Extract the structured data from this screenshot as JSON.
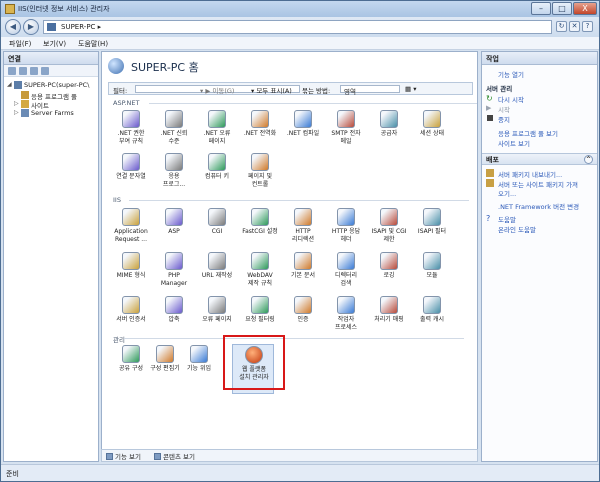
{
  "window": {
    "title": "IIS(인터넷 정보 서비스) 관리자",
    "min_label": "–",
    "max_label": "□",
    "close_label": "X"
  },
  "address": {
    "back": "◀",
    "forward": "▶",
    "path": "SUPER-PC ▸"
  },
  "menu": {
    "file": "파일(F)",
    "view": "보기(V)",
    "help": "도움말(H)"
  },
  "connections": {
    "header": "연결",
    "tree": [
      {
        "label": "SUPER-PC(super-PC\\",
        "expander": "◢"
      },
      {
        "label": "응용 프로그램 풀",
        "expander": ""
      },
      {
        "label": "사이트",
        "expander": "▷"
      },
      {
        "label": "Server Farms",
        "expander": "▷"
      }
    ]
  },
  "center": {
    "title": "SUPER-PC 홈",
    "filter": {
      "label": "필터:",
      "go": "▾ ▶ 이동(G)",
      "show_all": "▾ 모두 표시(A)",
      "group_by": "묶는 방법:",
      "group_value": "영역"
    },
    "categories": [
      "ASP.NET",
      "IIS",
      "관리"
    ],
    "aspnet_tiles": [
      ".NET 권한\n부여 규칙",
      ".NET 신뢰\n수준",
      ".NET 오류\n페이지",
      ".NET 전역화",
      ".NET 컴파일",
      "SMTP 전자\n메일",
      "공급자",
      "세션 상태",
      "연결 문자열",
      "응용\n프로그...",
      "컴퓨터 키",
      "페이지 및\n컨트롤"
    ],
    "iis_tiles": [
      "Application\nRequest ...",
      "ASP",
      "CGI",
      "FastCGI 설정",
      "HTTP\n리디렉션",
      "HTTP 응답\n헤더",
      "ISAPI 및 CGI\n제한",
      "ISAPI 필터",
      "MIME 형식",
      "PHP\nManager",
      "URL 재작성",
      "WebDAV\n제작 규칙",
      "기본 문서",
      "디렉터리\n검색",
      "로깅",
      "모듈",
      "서버 인증서",
      "압축",
      "오류 페이지",
      "요청 필터링",
      "인증",
      "작업자\n프로세스",
      "처리기 매핑",
      "출력 캐시"
    ],
    "mgmt_tiles": [
      "공유 구성",
      "구성 편집기",
      "기능 위임",
      "웹 플랫폼\n설치 관리자"
    ]
  },
  "bottom_tabs": {
    "features": "기능 보기",
    "content": "콘텐츠 보기"
  },
  "actions": {
    "header": "작업",
    "open_feature": "기능 열기",
    "server_mgmt": "서버 관리",
    "restart": "다시 시작",
    "start": "시작",
    "stop": "중지",
    "view_app_pools": "응용 프로그램 풀 보기",
    "view_sites": "사이트 보기",
    "deploy_header": "배포",
    "deploy_collapse": "^",
    "export_pkg": "서버 패키지 내보내기...",
    "import_pkg_1": "서버 또는 사이트 패키지 가져",
    "import_pkg_2": "오기...",
    "net_framework": ".NET Framework 버전 변경",
    "help": "도움말",
    "online_help": "온라인 도움말"
  },
  "status": {
    "text": "준비"
  },
  "colors": {
    "accent_red": "#d81818",
    "link_blue": "#2a58b8"
  }
}
